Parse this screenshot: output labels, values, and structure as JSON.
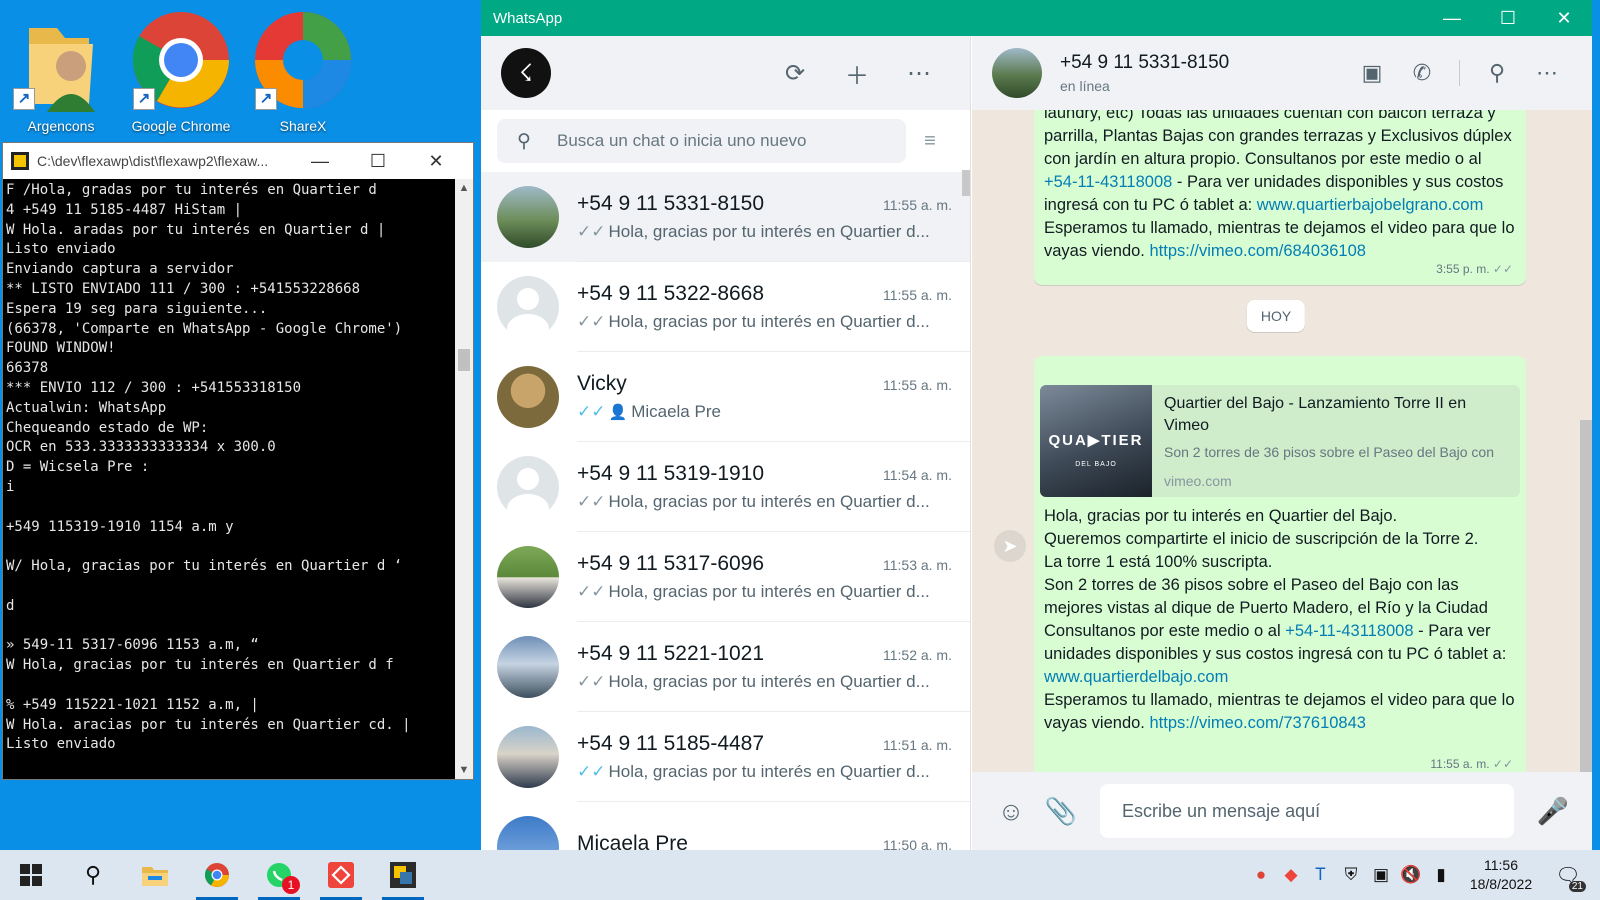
{
  "desktop": {
    "icons": [
      {
        "label": "Argencons"
      },
      {
        "label": "Google Chrome"
      },
      {
        "label": "ShareX"
      }
    ]
  },
  "console": {
    "title": "C:\\dev\\flexawp\\dist\\flexawp2\\flexaw...",
    "output": "F /Hola, gradas por tu interés en Quartier d\n4 +549 11 5185-4487 HiStam |\nW Hola. aradas por tu interés en Quartier d |\nListo enviado\nEnviando captura a servidor\n** LISTO ENVIADO 111 / 300 : +541553228668\nEspera 19 seg para siguiente...\n(66378, 'Comparte en WhatsApp - Google Chrome')\nFOUND WINDOW!\n66378\n*** ENVIO 112 / 300 : +541553318150\nActualwin: WhatsApp\nChequeando estado de WP:\nOCR en 533.3333333333334 x 300.0\nD = Wicsela Pre :\ni\n\n+549 115319-1910 1154 a.m y\n\nW/ Hola, gracias por tu interés en Quartier d ‘\n\nd\n\n» 549-11 5317-6096 1153 a.m, “\nW Hola, gracias por tu interés en Quartier d f\n\n% +549 115221-1021 1152 a.m, |\nW Hola. aracias por tu interés en Quartier cd. |\nListo enviado"
  },
  "whatsapp": {
    "window_title": "WhatsApp",
    "search_placeholder": "Busca un chat o inicia uno nuevo",
    "chats": [
      {
        "name": "+54 9 11 5331-8150",
        "time": "11:55 a. m.",
        "preview": "Hola, gracias por tu interés en Quartier d...",
        "tick": "✓✓",
        "read": false,
        "group": false,
        "selected": true,
        "avatar": "lake"
      },
      {
        "name": "+54 9 11 5322-8668",
        "time": "11:55 a. m.",
        "preview": "Hola, gracias por tu interés en Quartier d...",
        "tick": "✓✓",
        "read": false,
        "group": false,
        "selected": false,
        "avatar": "default"
      },
      {
        "name": "Vicky",
        "time": "11:55 a. m.",
        "preview": "Micaela Pre",
        "tick": "✓✓",
        "read": true,
        "group": true,
        "selected": false,
        "avatar": "vicky"
      },
      {
        "name": "+54 9 11 5319-1910",
        "time": "11:54 a. m.",
        "preview": "Hola, gracias por tu interés en Quartier d...",
        "tick": "✓✓",
        "read": false,
        "group": false,
        "selected": false,
        "avatar": "default"
      },
      {
        "name": "+54 9 11 5317-6096",
        "time": "11:53 a. m.",
        "preview": "Hola, gracias por tu interés en Quartier d...",
        "tick": "✓✓",
        "read": false,
        "group": false,
        "selected": false,
        "avatar": "wedding"
      },
      {
        "name": "+54 9 11 5221-1021",
        "time": "11:52 a. m.",
        "preview": "Hola, gracias por tu interés en Quartier d...",
        "tick": "✓✓",
        "read": false,
        "group": false,
        "selected": false,
        "avatar": "mountain"
      },
      {
        "name": "+54 9 11 5185-4487",
        "time": "11:51 a. m.",
        "preview": "Hola, gracias por tu interés en Quartier d...",
        "tick": "✓✓",
        "read": true,
        "group": false,
        "selected": false,
        "avatar": "couple"
      },
      {
        "name": "Micaela Pre",
        "time": "11:50 a. m.",
        "preview": "",
        "tick": "",
        "read": false,
        "group": false,
        "selected": false,
        "avatar": "sky"
      }
    ],
    "contact": {
      "name": "+54 9 11 5331-8150",
      "status": "en línea"
    },
    "messages": {
      "first": {
        "text1": "laundry, etc) Todas las unidades cuentan con balcón terraza y parrilla, Plantas Bajas con grandes terrazas y Exclusivos dúplex con jardín en altura propio. Consultanos por este medio o al ",
        "phone": "+54-11-43118008",
        "text2": " - Para ver unidades disponibles y sus costos ingresá con tu PC ó tablet a: ",
        "site": "www.quartierbajobelgrano.com",
        "text3": " Esperamos tu llamado, mientras te dejamos el video para que lo vayas viendo. ",
        "video": "https://vimeo.com/684036108",
        "time": "3:55 p. m."
      },
      "day_label": "HOY",
      "second": {
        "preview_title": "Quartier del Bajo - Lanzamiento Torre II en Vimeo",
        "preview_desc": "Son 2 torres de 36 pisos sobre el Paseo del Bajo con",
        "preview_domain": "vimeo.com",
        "thumb_title": "QUA▶TIER",
        "thumb_sub": "DEL BAJO",
        "text1": "Hola, gracias por tu interés en Quartier del Bajo.\nQueremos compartirte el inicio de suscripción de la Torre 2.\nLa torre 1 está 100% suscripta.\nSon 2 torres de 36 pisos sobre el Paseo del Bajo con las mejores vistas al dique de Puerto Madero, el Río y la Ciudad\nConsultanos por este medio o al ",
        "phone": "+54-11-43118008",
        "text2": " - Para ver unidades disponibles y sus costos ingresá con tu PC ó tablet a: ",
        "site": "www.quartierdelbajo.com",
        "text3": "\nEsperamos tu llamado, mientras te dejamos el video para que lo vayas viendo. ",
        "video": "https://vimeo.com/737610843",
        "time": "11:55 a. m."
      }
    },
    "compose_placeholder": "Escribe un mensaje aquí",
    "unread_badge": "1"
  },
  "taskbar": {
    "time": "11:56",
    "date": "18/8/2022",
    "notifications": "21"
  },
  "colors": {
    "whatsapp_green": "#00a884",
    "bubble_out": "#d9fdd3",
    "chat_bg": "#efe7dd",
    "read_tick": "#53bdeb",
    "link": "#027eb5"
  }
}
